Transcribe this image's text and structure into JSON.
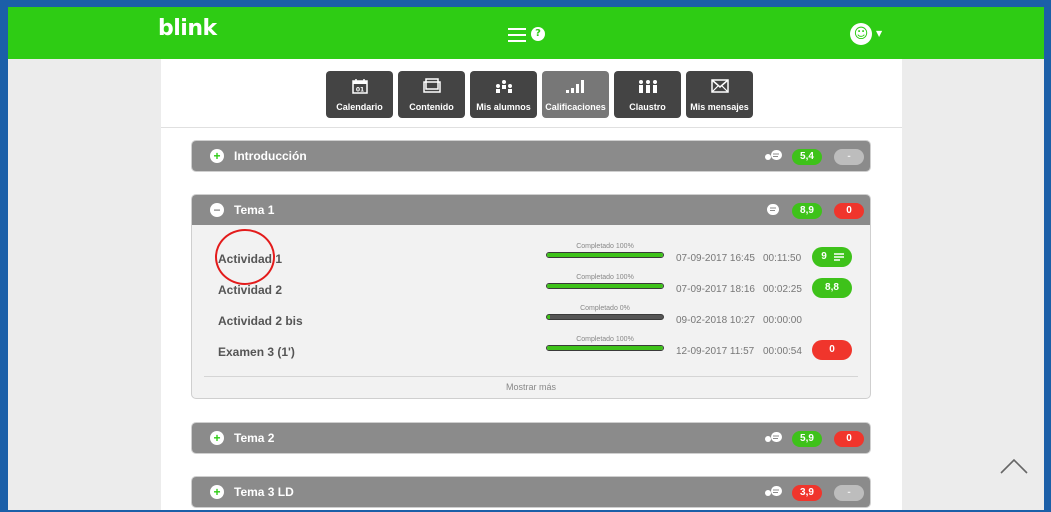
{
  "header": {
    "logo": "blink",
    "avatar_glyph": "☺",
    "help_glyph": "?"
  },
  "nav": {
    "items": [
      {
        "label": "Calendario",
        "icon": "calendar-icon",
        "day": "01"
      },
      {
        "label": "Contenido",
        "icon": "content-icon"
      },
      {
        "label": "Mis alumnos",
        "icon": "students-icon"
      },
      {
        "label": "Calificaciones",
        "icon": "grades-icon",
        "active": true
      },
      {
        "label": "Claustro",
        "icon": "staff-icon"
      },
      {
        "label": "Mis mensajes",
        "icon": "envelope-icon"
      }
    ]
  },
  "sections": [
    {
      "title": "Introducción",
      "expanded": false,
      "grade_left": "5,4",
      "grade_right": "-"
    },
    {
      "title": "Tema 1",
      "expanded": true,
      "grade_left": "8,9",
      "grade_right": "0",
      "activities": [
        {
          "name": "Actividad 1",
          "progress_label": "Completado 100%",
          "progress": 1.0,
          "date": "07-09-2017 16:45",
          "time": "00:11:50",
          "grade": "9"
        },
        {
          "name": "Actividad 2",
          "progress_label": "Completado 100%",
          "progress": 1.0,
          "date": "07-09-2017 18:16",
          "time": "00:02:25",
          "grade": "8,8"
        },
        {
          "name": "Actividad 2 bis",
          "progress_label": "Completado 0%",
          "progress": 0.0,
          "date": "09-02-2018 10:27",
          "time": "00:00:00",
          "grade": ""
        },
        {
          "name": "Examen 3 (1')",
          "progress_label": "Completado 100%",
          "progress": 1.0,
          "date": "12-09-2017 11:57",
          "time": "00:00:54",
          "grade": "0"
        }
      ],
      "show_more": "Mostrar más"
    },
    {
      "title": "Tema 2",
      "expanded": false,
      "grade_left": "5,9",
      "grade_right": "0"
    },
    {
      "title": "Tema 3 LD",
      "expanded": false,
      "grade_left": "3,9",
      "grade_right": "-"
    }
  ],
  "colors": {
    "green": "#2ecc14",
    "red": "#f0352c",
    "gray_header": "#8b8b8b"
  }
}
